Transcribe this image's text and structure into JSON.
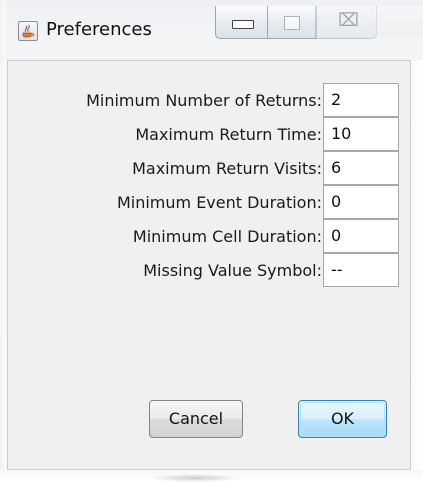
{
  "window": {
    "title": "Preferences",
    "icon": "java-cup-icon",
    "controls": {
      "minimize_icon": "minimize-icon",
      "maximize_icon": "maximize-icon",
      "close_glyph": "⌧"
    }
  },
  "fields": [
    {
      "label": "Minimum Number of Returns:",
      "value": "2"
    },
    {
      "label": "Maximum Return Time:",
      "value": "10"
    },
    {
      "label": "Maximum Return Visits:",
      "value": "6"
    },
    {
      "label": "Minimum Event Duration:",
      "value": "0"
    },
    {
      "label": "Minimum Cell Duration:",
      "value": "0"
    },
    {
      "label": "Missing Value Symbol:",
      "value": "--"
    }
  ],
  "buttons": {
    "cancel": "Cancel",
    "ok": "OK"
  },
  "colors": {
    "dialog_bg": "#f0f0f0",
    "ok_button_border": "#3c7fb1",
    "field_border": "#a7a7a7"
  }
}
